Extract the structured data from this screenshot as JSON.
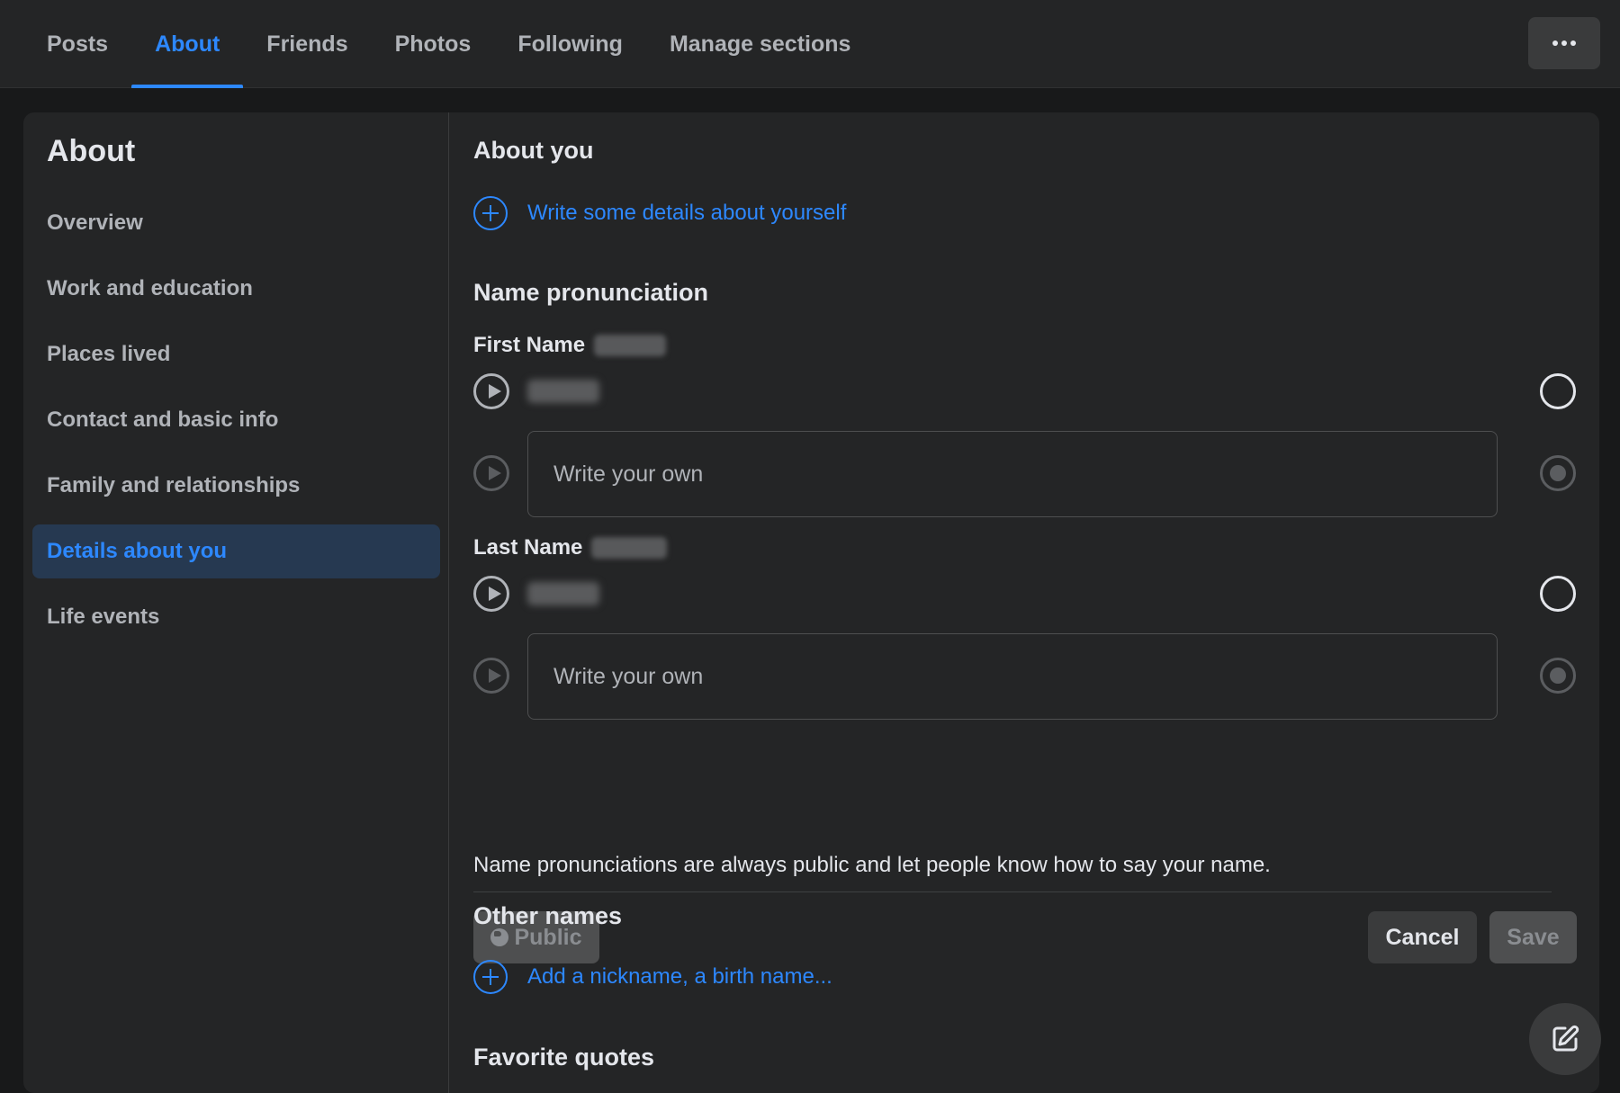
{
  "tabs": [
    {
      "label": "Posts"
    },
    {
      "label": "About"
    },
    {
      "label": "Friends"
    },
    {
      "label": "Photos"
    },
    {
      "label": "Following"
    },
    {
      "label": "Manage sections"
    }
  ],
  "active_tab": "About",
  "more_button_icon": "more-horizontal-icon",
  "sidebar": {
    "title": "About",
    "items": [
      {
        "label": "Overview"
      },
      {
        "label": "Work and education"
      },
      {
        "label": "Places lived"
      },
      {
        "label": "Contact and basic info"
      },
      {
        "label": "Family and relationships"
      },
      {
        "label": "Details about you"
      },
      {
        "label": "Life events"
      }
    ],
    "active_item": "Details about you"
  },
  "about_you": {
    "title": "About you",
    "add_link": "Write some details about yourself"
  },
  "name_pronunciation": {
    "title": "Name pronunciation",
    "first_name_label": "First Name",
    "last_name_label": "Last Name",
    "write_own_placeholder": "Write your own",
    "note": "Name pronunciations are always public and let people know how to say your name.",
    "privacy_label": "Public",
    "cancel_label": "Cancel",
    "save_label": "Save"
  },
  "other_names": {
    "title": "Other names",
    "add_link": "Add a nickname, a birth name..."
  },
  "favorite_quotes": {
    "title": "Favorite quotes"
  },
  "colors": {
    "accent": "#2d88ff",
    "background": "#18191a",
    "surface": "#242526",
    "active_nav_bg": "#263951"
  }
}
